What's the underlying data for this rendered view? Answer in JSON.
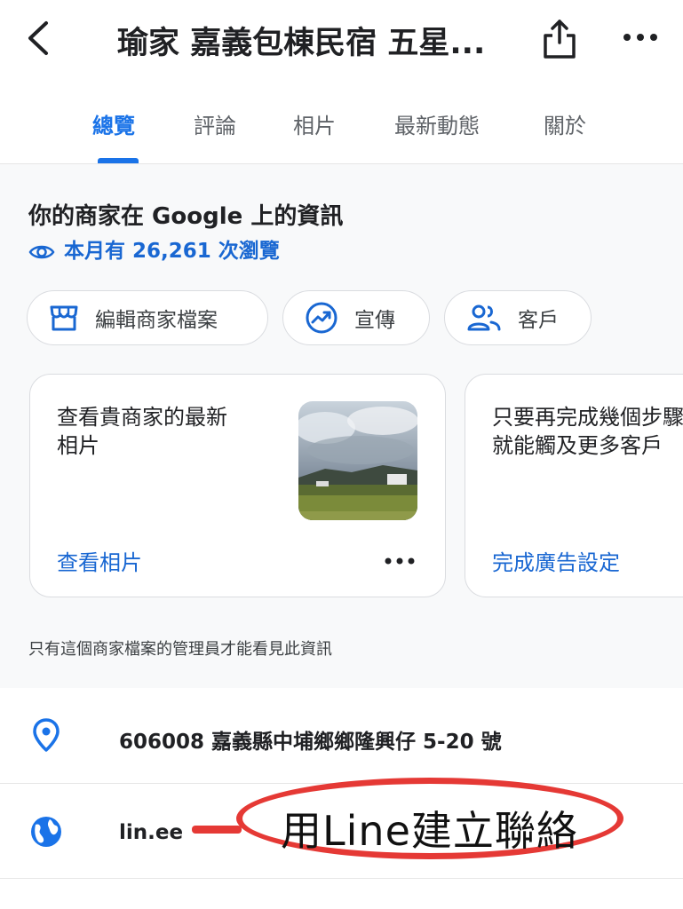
{
  "header": {
    "title": "瑜家 嘉義包棟民宿 五星..."
  },
  "tabs": [
    {
      "label": "總覽",
      "active": true
    },
    {
      "label": "評論",
      "active": false
    },
    {
      "label": "相片",
      "active": false
    },
    {
      "label": "最新動態",
      "active": false
    },
    {
      "label": "關於",
      "active": false
    }
  ],
  "business": {
    "title": "你的商家在 Google 上的資訊",
    "views": "本月有 26,261 次瀏覽"
  },
  "chips": [
    {
      "label": "編輯商家檔案",
      "icon": "storefront-icon"
    },
    {
      "label": "宣傳",
      "icon": "trending-up-icon"
    },
    {
      "label": "客戶",
      "icon": "people-icon"
    }
  ],
  "cards": [
    {
      "text_line1": "查看貴商家的最新",
      "text_line2": "相片",
      "link": "查看相片"
    },
    {
      "text_line1": "只要再完成幾個步驟",
      "text_line2": "就能觸及更多客戶",
      "link": "完成廣告設定"
    }
  ],
  "note": "只有這個商家檔案的管理員才能看見此資訊",
  "info": {
    "address": "606008 嘉義縣中埔鄉鄉隆興仔 5-20 號",
    "website": "lin.ee"
  },
  "annotation": {
    "text": "用Line建立聯絡",
    "color": "#e53935"
  },
  "colors": {
    "accent": "#1a73e8",
    "link": "#1967d2",
    "panel_bg": "#f8f9fa"
  }
}
